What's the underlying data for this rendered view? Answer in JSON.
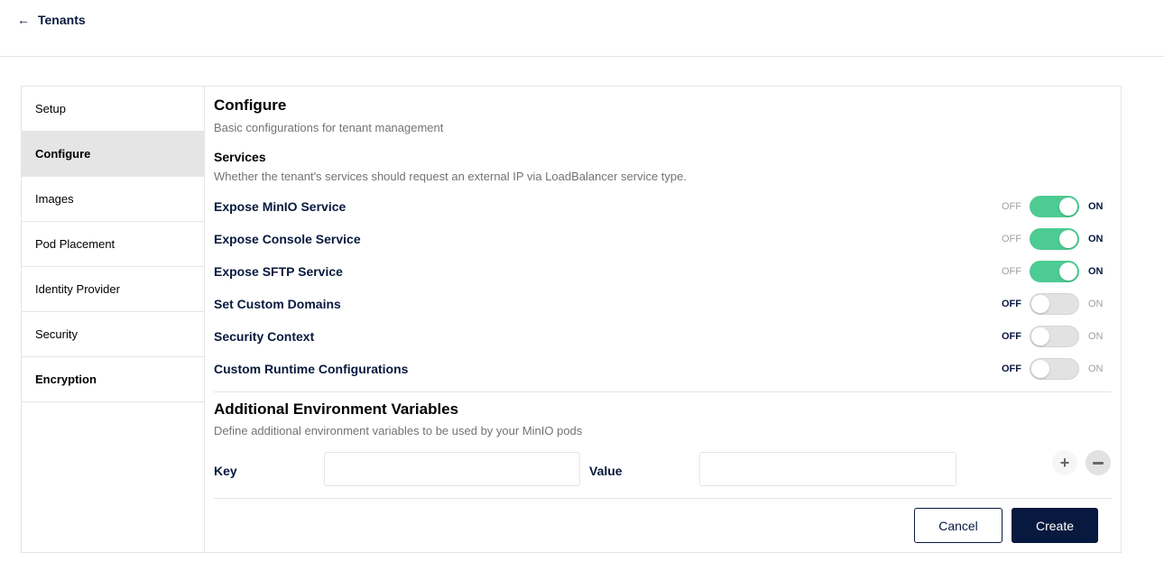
{
  "header": {
    "back_label": "Tenants"
  },
  "sidebar": {
    "items": [
      {
        "label": "Setup"
      },
      {
        "label": "Configure"
      },
      {
        "label": "Images"
      },
      {
        "label": "Pod Placement"
      },
      {
        "label": "Identity Provider"
      },
      {
        "label": "Security"
      },
      {
        "label": "Encryption"
      }
    ],
    "active": "Configure"
  },
  "configure": {
    "title": "Configure",
    "subtitle": "Basic configurations for tenant management",
    "services_title": "Services",
    "services_subtitle": "Whether the tenant's services should request an external IP via LoadBalancer service type.",
    "off_label": "OFF",
    "on_label": "ON",
    "toggles": [
      {
        "label": "Expose MinIO Service",
        "state": true
      },
      {
        "label": "Expose Console Service",
        "state": true
      },
      {
        "label": "Expose SFTP Service",
        "state": true
      },
      {
        "label": "Set Custom Domains",
        "state": false
      },
      {
        "label": "Security Context",
        "state": false
      },
      {
        "label": "Custom Runtime Configurations",
        "state": false
      }
    ]
  },
  "env": {
    "title": "Additional Environment Variables",
    "subtitle": "Define additional environment variables to be used by your MinIO pods",
    "key_label": "Key",
    "key_value": "",
    "value_label": "Value",
    "value_value": ""
  },
  "actions": {
    "cancel_label": "Cancel",
    "create_label": "Create"
  },
  "colors": {
    "accent": "#4ccb92",
    "primary": "#07193e",
    "muted": "#737373",
    "border": "#e5e5e5"
  },
  "icons": {
    "back": "arrow-left-icon",
    "add": "plus-icon",
    "remove": "minus-icon"
  }
}
